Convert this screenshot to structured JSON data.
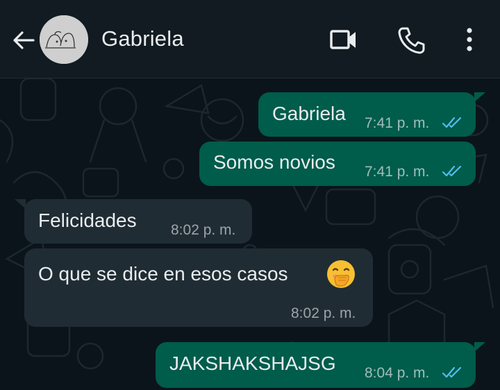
{
  "header": {
    "contact_name": "Gabriela",
    "back_icon": "arrow-left-icon",
    "video_icon": "video-camera-icon",
    "call_icon": "phone-icon",
    "menu_icon": "more-vertical-icon"
  },
  "messages": [
    {
      "direction": "out",
      "text": "Gabriela",
      "time": "7:41 p. m.",
      "status": "read"
    },
    {
      "direction": "out",
      "text": "Somos novios",
      "time": "7:41 p. m.",
      "status": "read"
    },
    {
      "direction": "in",
      "text": "Felicidades",
      "time": "8:02 p. m."
    },
    {
      "direction": "in",
      "text": "O que se dice en esos casos",
      "emoji": "face-with-hand-over-mouth",
      "time": "8:02 p. m."
    },
    {
      "direction": "out",
      "text": "JAKSHAKSHAJSG",
      "time": "8:04 p. m.",
      "status": "read"
    }
  ],
  "colors": {
    "header_bg": "#111b21",
    "chat_bg": "#0b141a",
    "outgoing_bubble": "#005c4b",
    "incoming_bubble": "#202c33",
    "read_ticks": "#53bdeb"
  }
}
